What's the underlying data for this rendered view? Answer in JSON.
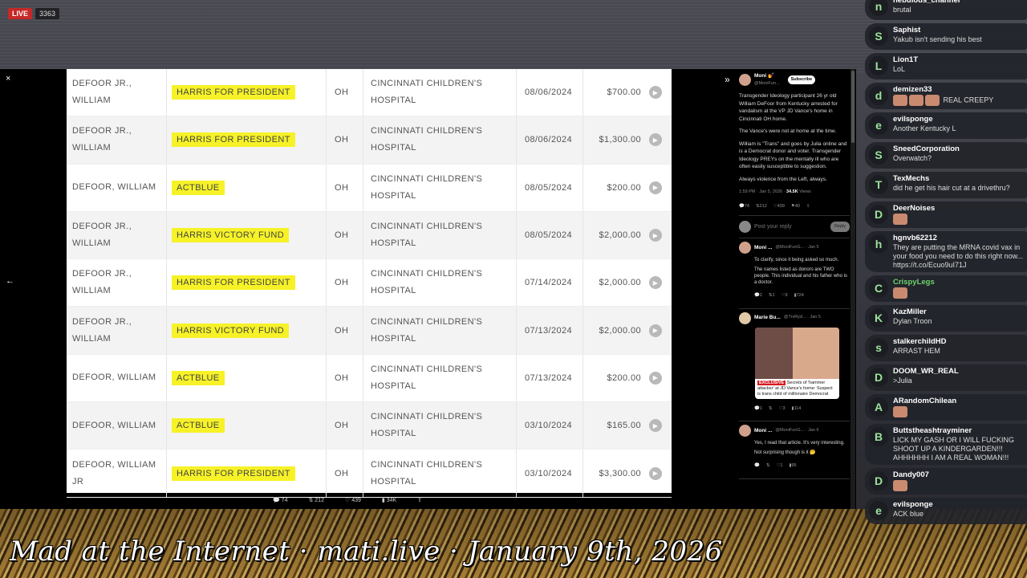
{
  "stream": {
    "live_label": "LIVE",
    "viewer_count": "3363"
  },
  "banner": "Mad at the Internet · mati.live · January 9th, 2026",
  "video": {
    "close_glyph": "×",
    "left_glyph": "←",
    "expand_glyph": "»",
    "donations": [
      {
        "name": "DEFOOR JR., WILLIAM",
        "committee": "HARRIS FOR PRESIDENT",
        "state": "OH",
        "employer": "CINCINNATI CHILDREN'S HOSPITAL",
        "date": "08/06/2024",
        "amount": "$700.00"
      },
      {
        "name": "DEFOOR JR., WILLIAM",
        "committee": "HARRIS FOR PRESIDENT",
        "state": "OH",
        "employer": "CINCINNATI CHILDREN'S HOSPITAL",
        "date": "08/06/2024",
        "amount": "$1,300.00"
      },
      {
        "name": "DEFOOR, WILLIAM",
        "committee": "ACTBLUE",
        "state": "OH",
        "employer": "CINCINNATI CHILDREN'S HOSPITAL",
        "date": "08/05/2024",
        "amount": "$200.00"
      },
      {
        "name": "DEFOOR JR., WILLIAM",
        "committee": "HARRIS VICTORY FUND",
        "state": "OH",
        "employer": "CINCINNATI CHILDREN'S HOSPITAL",
        "date": "08/05/2024",
        "amount": "$2,000.00"
      },
      {
        "name": "DEFOOR JR., WILLIAM",
        "committee": "HARRIS FOR PRESIDENT",
        "state": "OH",
        "employer": "CINCINNATI CHILDREN'S HOSPITAL",
        "date": "07/14/2024",
        "amount": "$2,000.00"
      },
      {
        "name": "DEFOOR JR., WILLIAM",
        "committee": "HARRIS VICTORY FUND",
        "state": "OH",
        "employer": "CINCINNATI CHILDREN'S HOSPITAL",
        "date": "07/13/2024",
        "amount": "$2,000.00"
      },
      {
        "name": "DEFOOR, WILLIAM",
        "committee": "ACTBLUE",
        "state": "OH",
        "employer": "CINCINNATI CHILDREN'S HOSPITAL",
        "date": "07/13/2024",
        "amount": "$200.00"
      },
      {
        "name": "DEFOOR, WILLIAM",
        "committee": "ACTBLUE",
        "state": "OH",
        "employer": "CINCINNATI CHILDREN'S HOSPITAL",
        "date": "03/10/2024",
        "amount": "$165.00"
      },
      {
        "name": "DEFOOR, WILLIAM JR",
        "committee": "HARRIS FOR PRESIDENT",
        "state": "OH",
        "employer": "CINCINNATI CHILDREN'S HOSPITAL",
        "date": "03/10/2024",
        "amount": "$3,300.00"
      }
    ],
    "stats": {
      "replies": "74",
      "reposts": "212",
      "likes": "439",
      "views": "34K"
    }
  },
  "tweet": {
    "user": "Moni 💅",
    "handle": "@MoniFun...",
    "subscribe": "Subscribe",
    "paragraphs": [
      "Transgender Ideology participant 26 yr old William DeFoor from Kentucky arrested for vandalism at the VP JD Vance's home in Cincinnati OH home.",
      "The Vance's were not at home at the time.",
      "William is \"Trans\" and goes by Julia online and is a Democrat donor and voter. Transgender Ideology PREYs on the mentally ill who are often easily susceptible to suggestion.",
      "Always violence from the Left, always."
    ],
    "meta": "1:59 PM · Jan 5, 2026 ·",
    "views": "34.5K",
    "views_label": "Views",
    "actions": {
      "replies": "74",
      "reposts": "212",
      "likes": "439",
      "bookmarks": "40"
    },
    "reply_placeholder": "Post your reply",
    "reply_button": "Reply",
    "replies": [
      {
        "user": "Moni ...",
        "handle": "@MoniFunG... · Jan 5",
        "paragraphs": [
          "To clarify, since it being asked so much.",
          "The names listed as donors are TWO people. This individual and his father who is a doctor."
        ],
        "stats": {
          "replies": "2",
          "reposts": "1",
          "likes": "9",
          "views": "724"
        }
      },
      {
        "user": "Marie Bu...",
        "handle": "@TrsRyd... · Jan 5",
        "exclusive": "EXCLUSIVE",
        "card_text": "Secrets of 'hammer attacker' at JD Vance's home: Suspect is trans child of millionaire Democrat",
        "stats": {
          "replies": "1",
          "reposts": "",
          "likes": "3",
          "views": "114"
        }
      },
      {
        "user": "Moni ...",
        "handle": "@MoniFunG... · Jan 6",
        "paragraphs": [
          "Yes, I read that article. It's very interesting.",
          "Not surprising though is it 🤔"
        ],
        "stats": {
          "replies": "",
          "reposts": "",
          "likes": "1",
          "views": "95"
        }
      }
    ]
  },
  "chat": [
    {
      "letter": "n",
      "name": "nebulous_channel",
      "text": "brutal"
    },
    {
      "letter": "S",
      "name": "Saphist",
      "text": "Yakub isn't sending his best"
    },
    {
      "letter": "L",
      "name": "Lion1T",
      "text": "LoL"
    },
    {
      "letter": "d",
      "name": "demizen33",
      "text": "REAL CREEPY"
    },
    {
      "letter": "e",
      "name": "evilsponge",
      "text": "Another Kentucky L"
    },
    {
      "letter": "S",
      "name": "SneedCorporation",
      "text": "Overwatch?"
    },
    {
      "letter": "T",
      "name": "TexMechs",
      "text": "did he get his hair cut at a drivethru?"
    },
    {
      "letter": "D",
      "name": "DeerNoises",
      "text": ""
    },
    {
      "letter": "h",
      "name": "hgnvb62212",
      "text": "They are putting the MRNA covid vax in your food you need to do this right now... https://t.co/Ecuo9uI71J"
    },
    {
      "letter": "C",
      "name": "CrispyLegs",
      "text": ""
    },
    {
      "letter": "K",
      "name": "KazMiller",
      "text": "Dylan Troon"
    },
    {
      "letter": "s",
      "name": "stalkerchildHD",
      "text": "ARRAST HEM"
    },
    {
      "letter": "D",
      "name": "DOOM_WR_REAL",
      "text": ">Julia"
    },
    {
      "letter": "A",
      "name": "ARandomChilean",
      "text": ""
    },
    {
      "letter": "B",
      "name": "Buttstheashtrayminer",
      "text": "LICK MY GASH OR I WILL FUCKING SHOOT UP A KINDERGARDEN!!! AHHHHHH I AM A REAL WOMAN!!!"
    },
    {
      "letter": "D",
      "name": "Dandy007",
      "text": ""
    },
    {
      "letter": "e",
      "name": "evilsponge",
      "text": "ACK blue"
    }
  ]
}
